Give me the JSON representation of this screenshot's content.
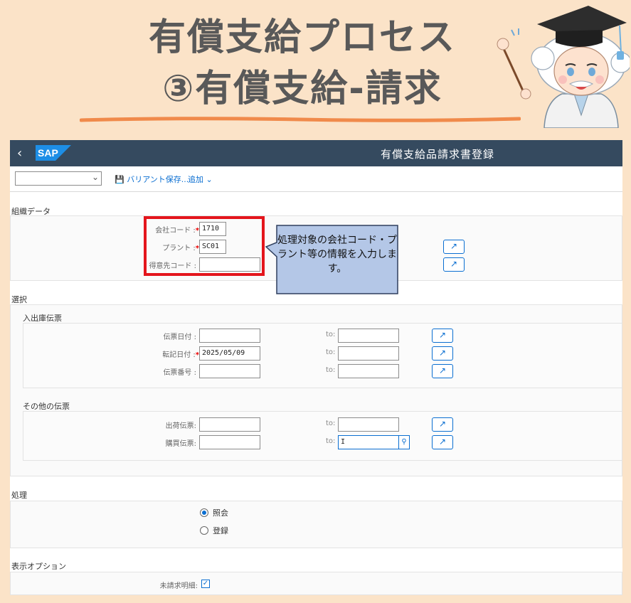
{
  "banner": {
    "title_line1": "有償支給プロセス",
    "title_line2": "③有償支給-請求"
  },
  "shell": {
    "logo": "SAP",
    "app_title": "有償支給品請求書登録",
    "back_icon": "chevron-left-icon"
  },
  "toolbar": {
    "variant_value": "",
    "save_variant_label": "バリアント保存...",
    "add_label": "追加"
  },
  "org_data": {
    "section_title": "組織データ",
    "company_code_label": "会社コード :",
    "company_code_value": "1710",
    "plant_label": "プラント :",
    "plant_value": "SC01",
    "customer_code_label": "得意先コード :",
    "customer_code_value": ""
  },
  "callout": {
    "text": "処理対象の会社コード・プラント等の情報を入力します。",
    "border_color": "#e4151c",
    "fill_color": "#b4c7e7"
  },
  "selection": {
    "section_title": "選択",
    "inout_group_title": "入出庫伝票",
    "doc_date_label": "伝票日付 :",
    "doc_date_value": "",
    "posting_date_label": "転記日付 :",
    "posting_date_value": "2025/05/09",
    "doc_number_label": "伝票番号 :",
    "doc_number_value": "",
    "to_label": "to:",
    "other_group_title": "その他の伝票",
    "delivery_label": "出荷伝票:",
    "delivery_value": "",
    "purchase_label": "購買伝票:",
    "purchase_value": "",
    "purchase_to_value": "I"
  },
  "processing": {
    "section_title": "処理",
    "option_display": "照会",
    "option_register": "登録",
    "selected": "照会"
  },
  "display_options": {
    "section_title": "表示オプション",
    "unbilled_items_label": "未請求明細:",
    "unbilled_items_checked": true
  }
}
